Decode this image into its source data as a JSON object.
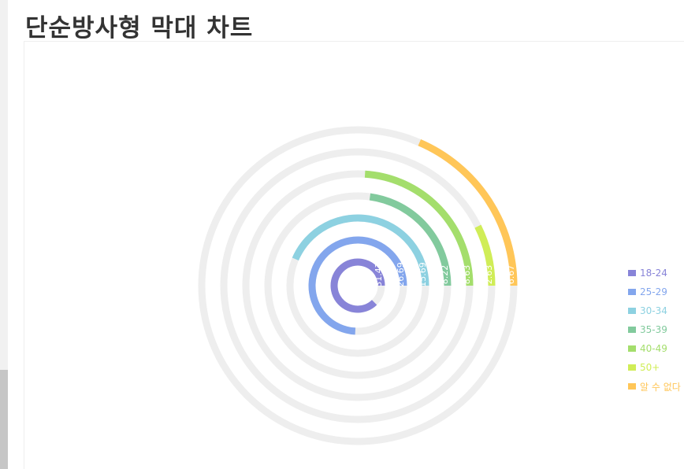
{
  "page": {
    "title": "단순방사형 막대 차트"
  },
  "chart_data": {
    "type": "radial-bar",
    "categories": [
      "18-24",
      "25-29",
      "30-34",
      "35-39",
      "40-49",
      "50+",
      "알 수 없다"
    ],
    "values": [
      31.47,
      26.69,
      15.69,
      8.22,
      8.63,
      2.63,
      6.67
    ],
    "max": 36,
    "track_color": "#eeeeee",
    "colors": [
      "#8884d8",
      "#83a6ed",
      "#8dd1e1",
      "#82ca9d",
      "#a4de6c",
      "#d0ed57",
      "#ffc658"
    ],
    "legend_position": "right-middle"
  }
}
